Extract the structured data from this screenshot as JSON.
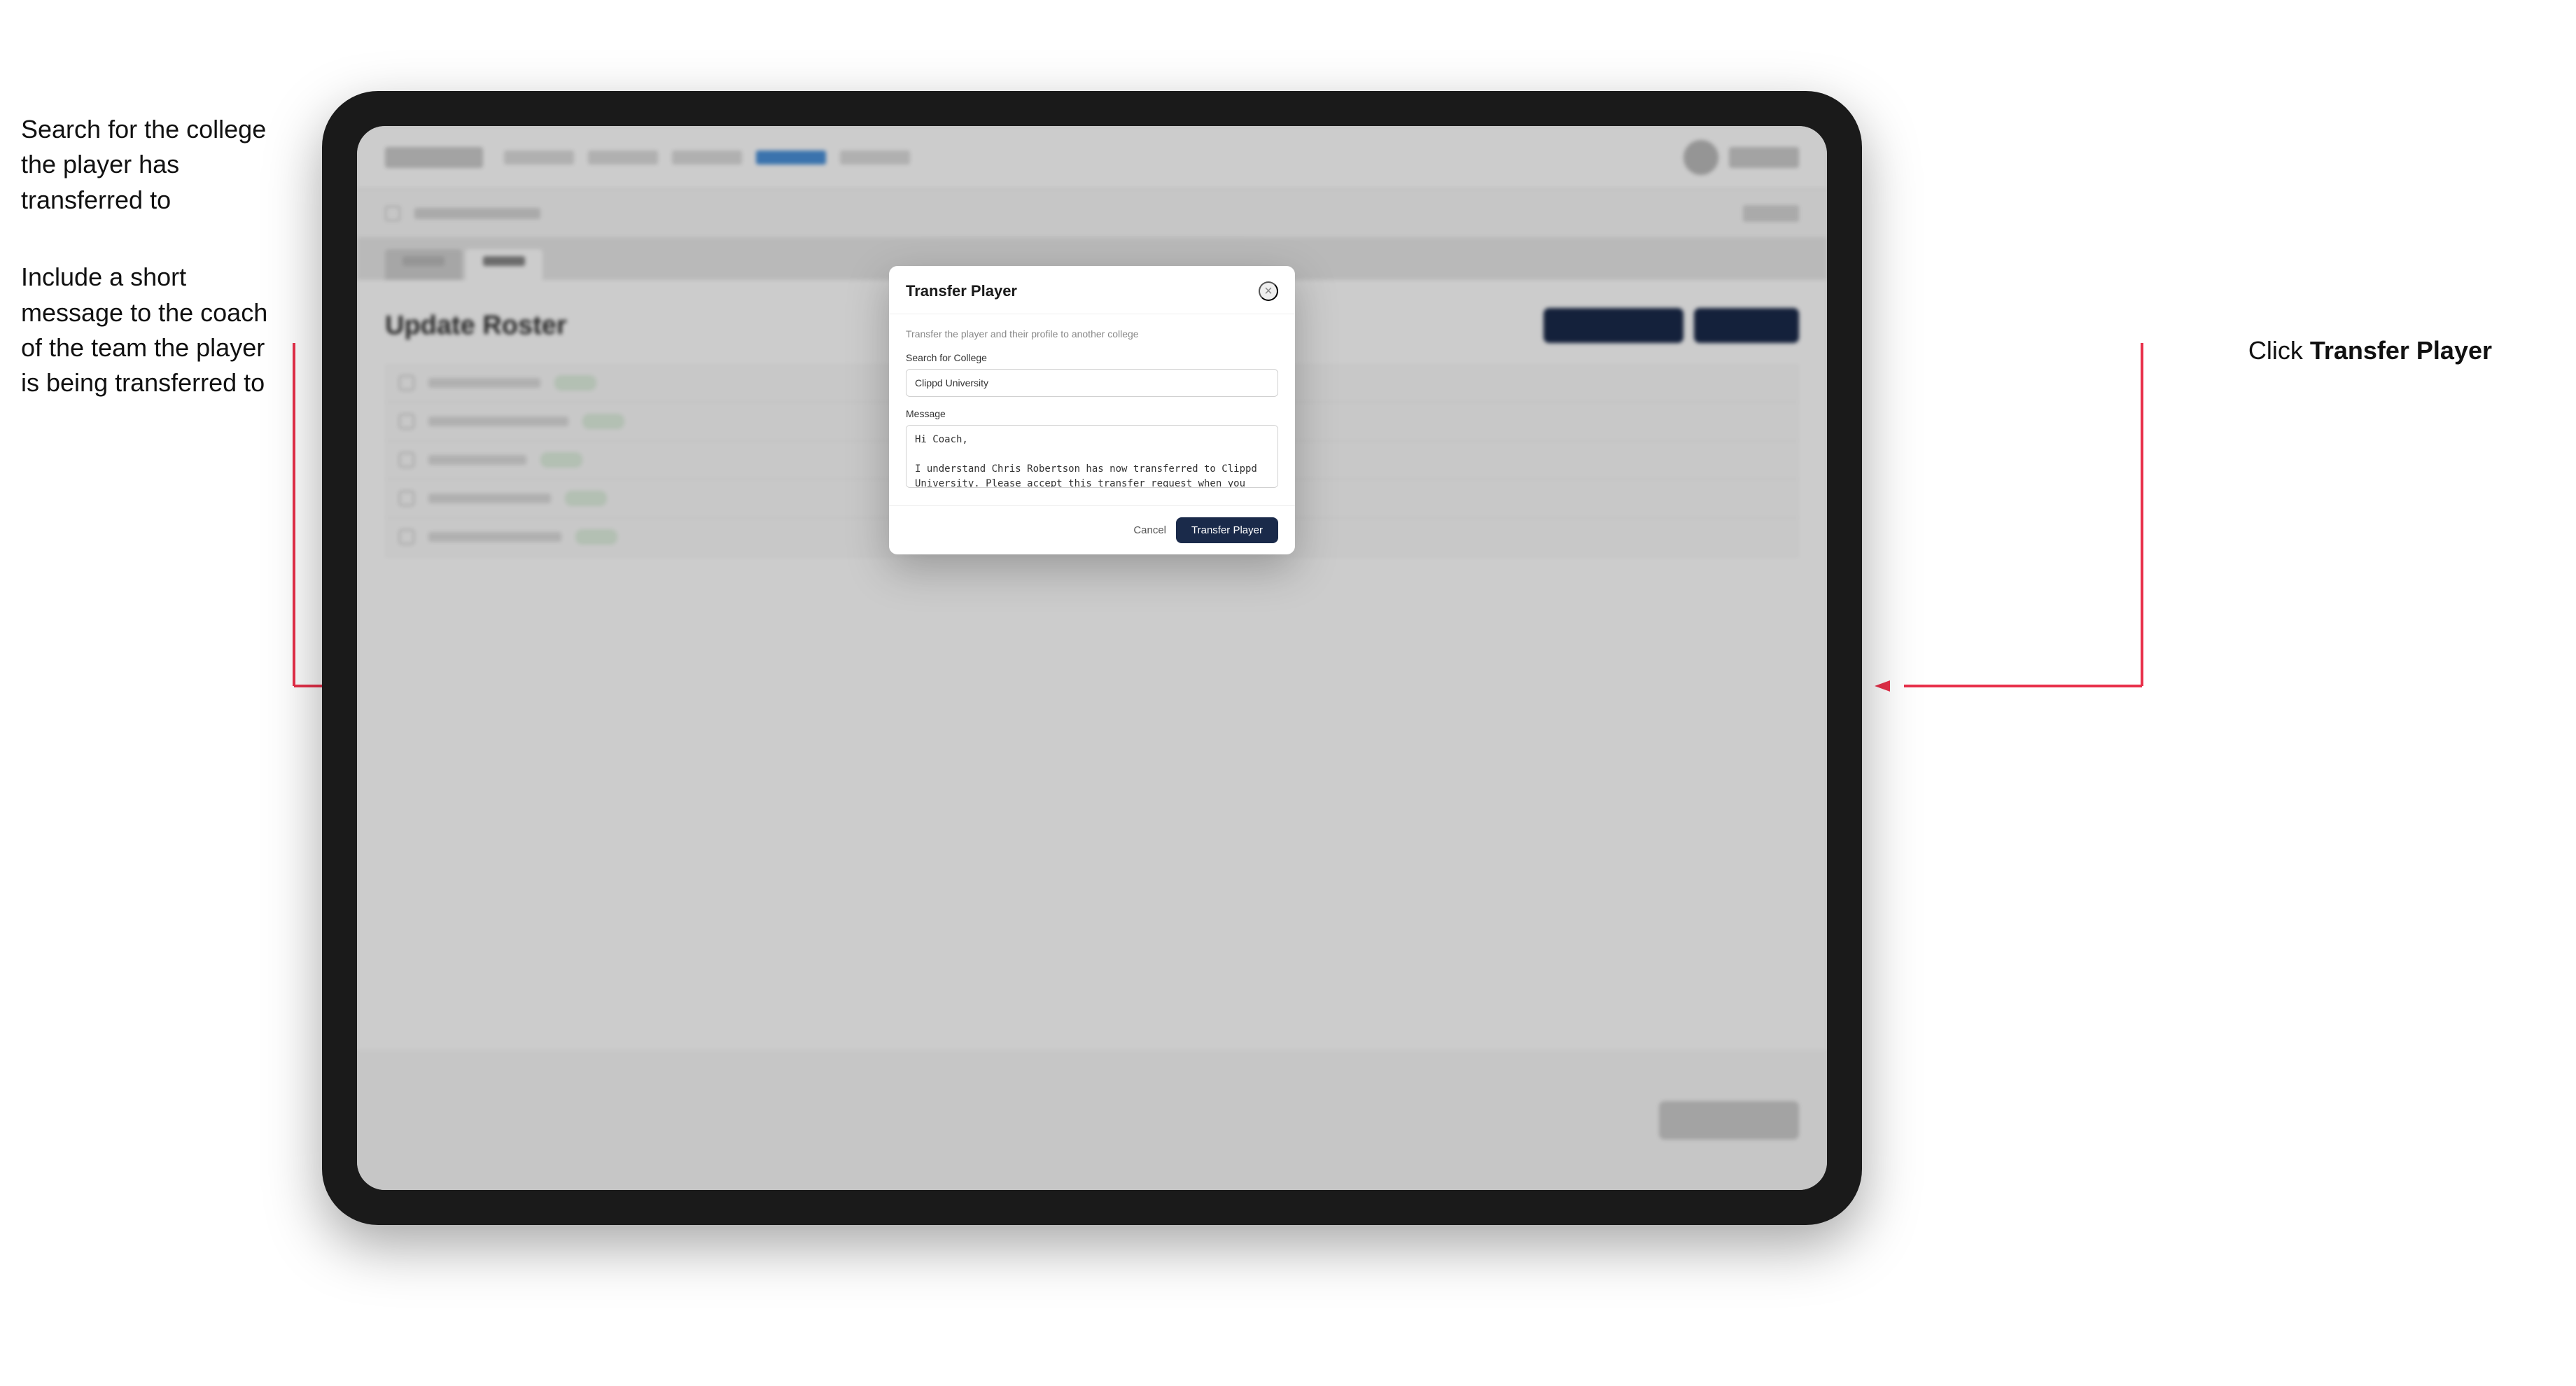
{
  "annotations": {
    "left_top": "Search for the college the player has transferred to",
    "left_bottom": "Include a short message to the coach of the team the player is being transferred to",
    "right": "Click ",
    "right_bold": "Transfer Player"
  },
  "dialog": {
    "title": "Transfer Player",
    "subtitle": "Transfer the player and their profile to another college",
    "search_label": "Search for College",
    "search_value": "Clippd University",
    "message_label": "Message",
    "message_value": "Hi Coach,\n\nI understand Chris Robertson has now transferred to Clippd University. Please accept this transfer request when you can.",
    "cancel_label": "Cancel",
    "transfer_label": "Transfer Player",
    "close_icon": "×"
  },
  "page": {
    "title": "Update Roster"
  }
}
